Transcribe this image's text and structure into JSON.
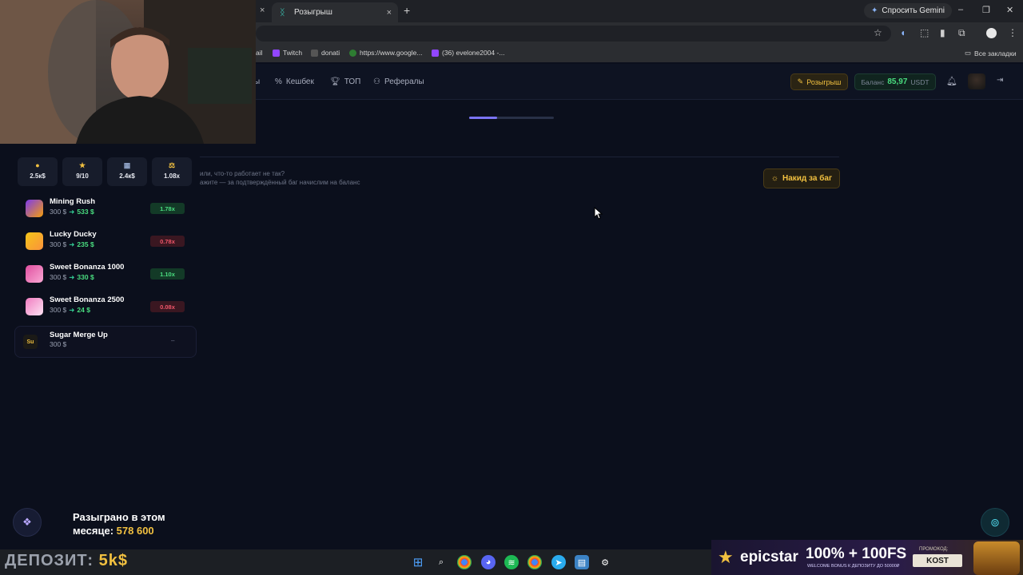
{
  "browser": {
    "tab_title": "Розыгрыш",
    "tab_close": "×",
    "prev_tab_close": "×",
    "new_tab": "+",
    "gemini_label": "Спросить Gemini",
    "win_minimize": "–",
    "win_restore": "❐",
    "win_close": "✕",
    "bookmarks": [
      {
        "label": "ail"
      },
      {
        "label": "Twitch",
        "color": "#9146ff"
      },
      {
        "label": "donati",
        "color": "#444444"
      },
      {
        "label": "https://www.google...",
        "color": "#2e7d32"
      },
      {
        "label": "(36) evelone2004 -...",
        "color": "#9146ff"
      }
    ],
    "all_bookmarks": "Все закладки"
  },
  "site": {
    "nav": {
      "partial": "ы",
      "cashback": "Кешбек",
      "top": "ТОП",
      "referrals": "Рефералы"
    },
    "promo_button": "Розыгрыш",
    "balance_label": "Баланс",
    "balance_value": "85,97",
    "balance_currency": "USDT",
    "loading_progress": 0.33,
    "bug_text_1": "или, что-то работает не так?",
    "bug_text_2": "ажите — за подтверждённый баг начислим на баланс",
    "bug_button": "Накид за баг"
  },
  "widget": {
    "stats": [
      {
        "icon": "money-bag",
        "value": "2.5к$"
      },
      {
        "icon": "star",
        "value": "9/10"
      },
      {
        "icon": "chart",
        "value": "2.4к$"
      },
      {
        "icon": "scales",
        "value": "1.08x"
      }
    ],
    "games": [
      {
        "name": "Mining Rush",
        "bet": "300 $",
        "win": "533 $",
        "multiplier": "1.78x",
        "positive": true,
        "color": "#7c3aed"
      },
      {
        "name": "Lucky Ducky",
        "bet": "300 $",
        "win": "235 $",
        "multiplier": "0.78x",
        "positive": false,
        "color": "#f5c518"
      },
      {
        "name": "Sweet Bonanza 1000",
        "bet": "300 $",
        "win": "330 $",
        "multiplier": "1.10x",
        "positive": true,
        "color": "#e04fa0"
      },
      {
        "name": "Sweet Bonanza 2500",
        "bet": "300 $",
        "win": "24 $",
        "multiplier": "0.08x",
        "positive": false,
        "color": "#f07cc0"
      },
      {
        "name": "Sugar Merge Up",
        "bet": "300 $",
        "win": "",
        "multiplier": "–",
        "abbr": "Su"
      }
    ]
  },
  "overlay": {
    "monthly_line1": "Разыграно в этом",
    "monthly_line2": "месяце:",
    "monthly_amount": "578 600",
    "deposit_label": "ДЕПОЗИТ:",
    "deposit_value": "5k$",
    "epic_logo": "epicstar",
    "epic_offer": "100% + 100FS",
    "epic_sub": "WELCOME BONUS К ДЕПОЗИТУ ДО 50000₽",
    "epic_promo_label": "ПРОМОКОД:",
    "epic_code": "KOST"
  }
}
